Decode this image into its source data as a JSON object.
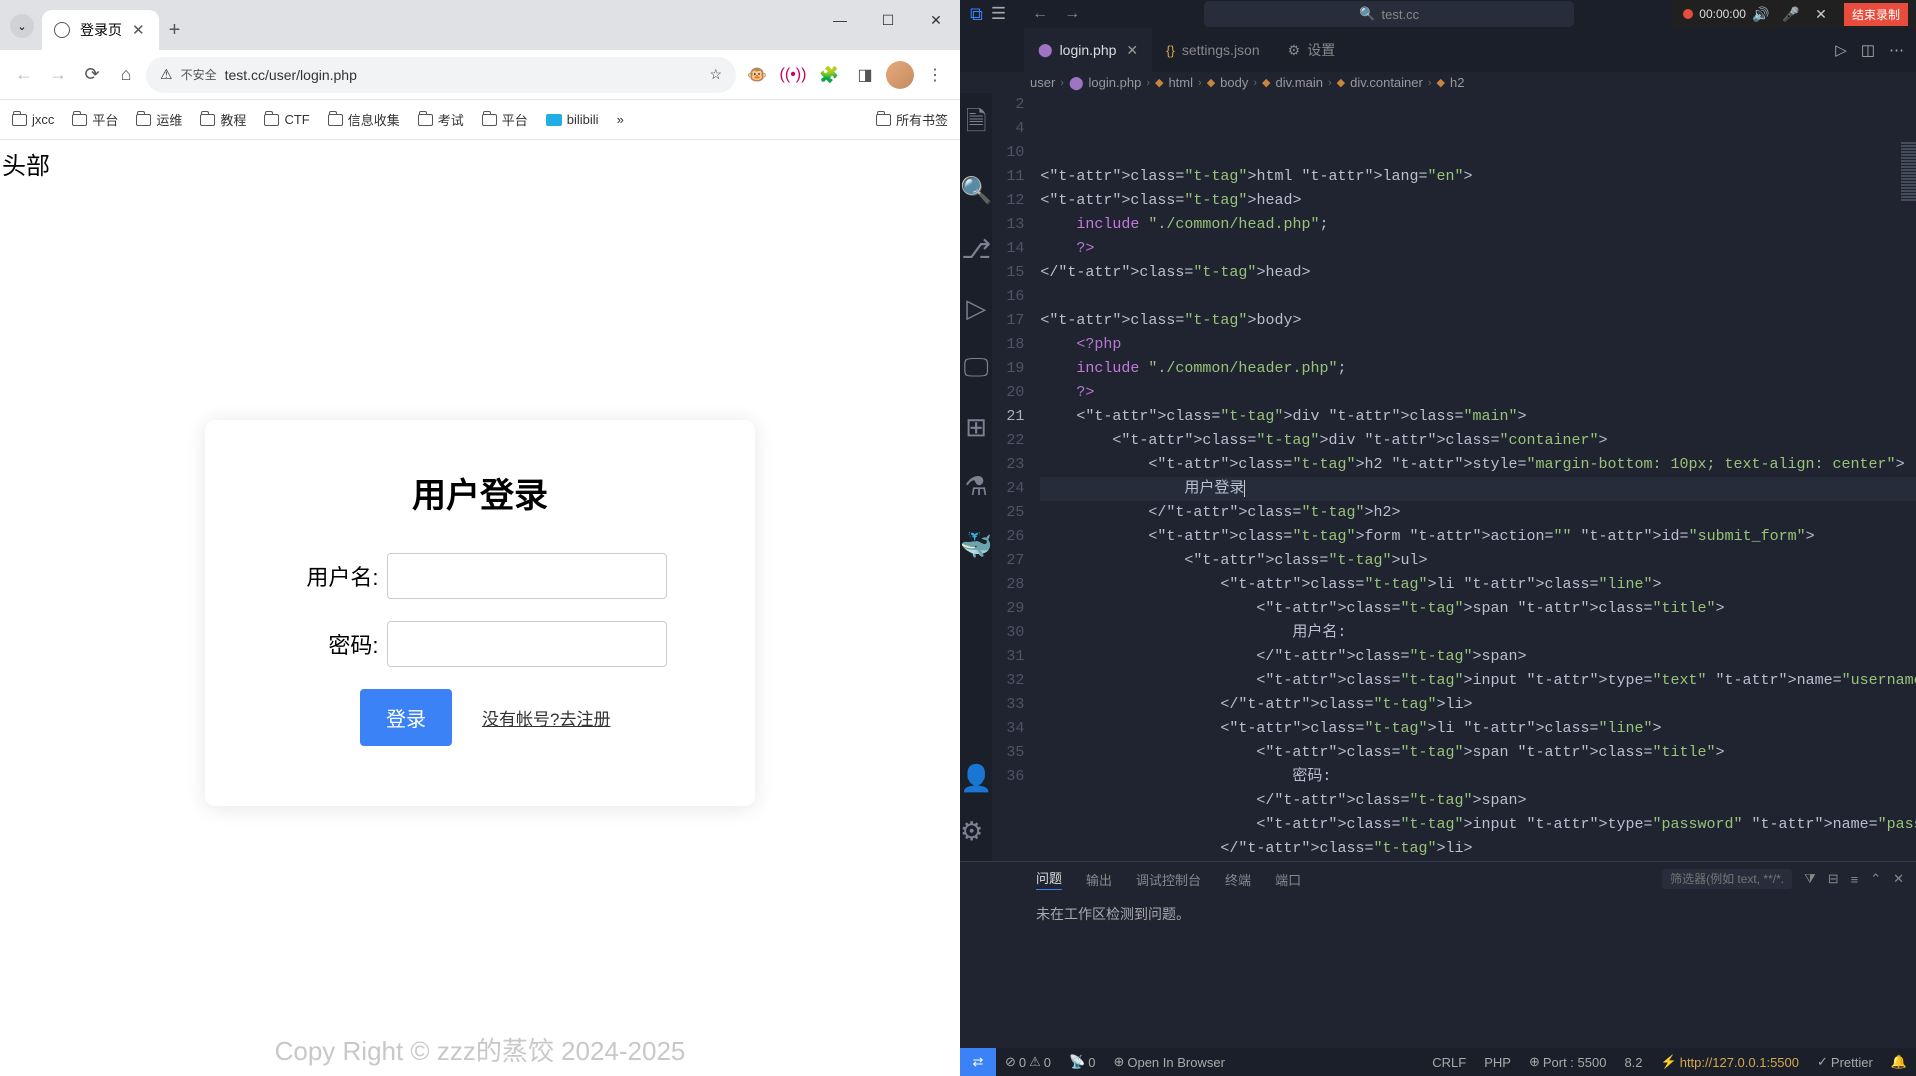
{
  "recbar": {
    "time": "00:00:00",
    "stop": "结束录制"
  },
  "browser": {
    "tab_title": "登录页",
    "window_ctrls": {
      "min": "—",
      "max": "☐",
      "close": "✕"
    },
    "nav": {
      "back": "←",
      "forward": "→",
      "reload": "⟳",
      "home": "⌂"
    },
    "not_secure": "不安全",
    "url": "test.cc/user/login.php",
    "star": "☆",
    "bookmarks": [
      "jxcc",
      "平台",
      "运维",
      "教程",
      "CTF",
      "信息收集",
      "考试",
      "平台"
    ],
    "bm_bili": "bilibili",
    "bm_more": "»",
    "bm_all": "所有书签",
    "page": {
      "head": "头部",
      "title": "用户登录",
      "user_label": "用户名:",
      "pass_label": "密码:",
      "login": "登录",
      "register": "没有帐号?去注册",
      "footer": "Copy Right © zzz的蒸饺 2024-2025"
    }
  },
  "vsc": {
    "title_search": "test.cc",
    "tabs": {
      "login": "login.php",
      "settings": "settings.json",
      "cfg": "设置"
    },
    "crumbs": [
      "user",
      "login.php",
      "html",
      "body",
      "div.main",
      "div.container",
      "h2"
    ],
    "lines": [
      {
        "n": "2",
        "c": "<html lang=\"en\">"
      },
      {
        "n": "4",
        "c": "<head>"
      },
      {
        "n": "10",
        "c": "    include \"./common/head.php\";"
      },
      {
        "n": "11",
        "c": "    ?>"
      },
      {
        "n": "12",
        "c": "</head>"
      },
      {
        "n": "13",
        "c": ""
      },
      {
        "n": "14",
        "c": "<body>"
      },
      {
        "n": "15",
        "c": "    <?php"
      },
      {
        "n": "16",
        "c": "    include \"./common/header.php\";"
      },
      {
        "n": "17",
        "c": "    ?>"
      },
      {
        "n": "18",
        "c": "    <div class=\"main\">"
      },
      {
        "n": "19",
        "c": "        <div class=\"container\">"
      },
      {
        "n": "20",
        "c": "            <h2 style=\"margin-bottom: 10px; text-align: center\">"
      },
      {
        "n": "21",
        "c": "                用户登录"
      },
      {
        "n": "22",
        "c": "            </h2>"
      },
      {
        "n": "23",
        "c": "            <form action=\"\" id=\"submit_form\">"
      },
      {
        "n": "24",
        "c": "                <ul>"
      },
      {
        "n": "25",
        "c": "                    <li class=\"line\">"
      },
      {
        "n": "26",
        "c": "                        <span class=\"title\">"
      },
      {
        "n": "27",
        "c": "                            用户名:"
      },
      {
        "n": "28",
        "c": "                        </span>"
      },
      {
        "n": "29",
        "c": "                        <input type=\"text\" name=\"username\">"
      },
      {
        "n": "30",
        "c": "                    </li>"
      },
      {
        "n": "31",
        "c": "                    <li class=\"line\">"
      },
      {
        "n": "32",
        "c": "                        <span class=\"title\">"
      },
      {
        "n": "33",
        "c": "                            密码:"
      },
      {
        "n": "34",
        "c": "                        </span>"
      },
      {
        "n": "35",
        "c": "                        <input type=\"password\" name=\"password\">"
      },
      {
        "n": "36",
        "c": "                    </li>"
      }
    ],
    "panel": {
      "tabs": [
        "问题",
        "输出",
        "调试控制台",
        "终端",
        "端口"
      ],
      "filter_ph": "筛选器(例如 text, **/*.t",
      "msg": "未在工作区检测到问题。"
    },
    "status": {
      "err": "0",
      "warn": "0",
      "port_fwd": "0",
      "open": "Open In Browser",
      "crlf": "CRLF",
      "lang": "PHP",
      "port": "Port : 5500",
      "ver": "8.2",
      "url": "http://127.0.0.1:5500",
      "prettier": "Prettier"
    }
  }
}
